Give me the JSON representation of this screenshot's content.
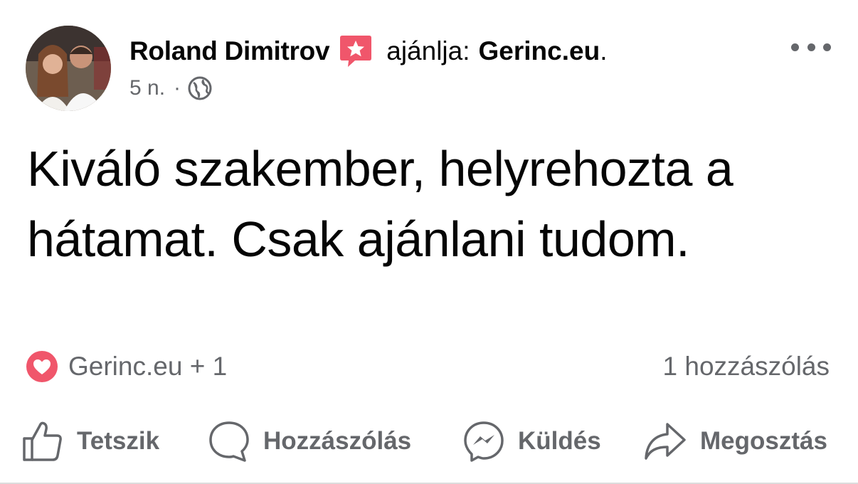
{
  "post": {
    "author": "Roland Dimitrov",
    "recommend_text": "ajánlja:",
    "recommend_target": "Gerinc.eu",
    "recommend_punct": ".",
    "time": "5 n.",
    "separator": "·",
    "privacy_icon": "globe-icon",
    "body": "Kiváló szakember, helyrehozta a hátamat. Csak ajánlani tudom.",
    "more_icon": "more-options-icon"
  },
  "reactions": {
    "icon": "love-reaction-icon",
    "summary": "Gerinc.eu + 1",
    "comments": "1 hozzászólás"
  },
  "actions": {
    "like": "Tetszik",
    "comment": "Hozzászólás",
    "send": "Küldés",
    "share": "Megosztás"
  },
  "colors": {
    "text": "#050505",
    "secondary": "#65676b",
    "recommend_badge": "#f0566b",
    "love_reaction": "#f0566b"
  }
}
